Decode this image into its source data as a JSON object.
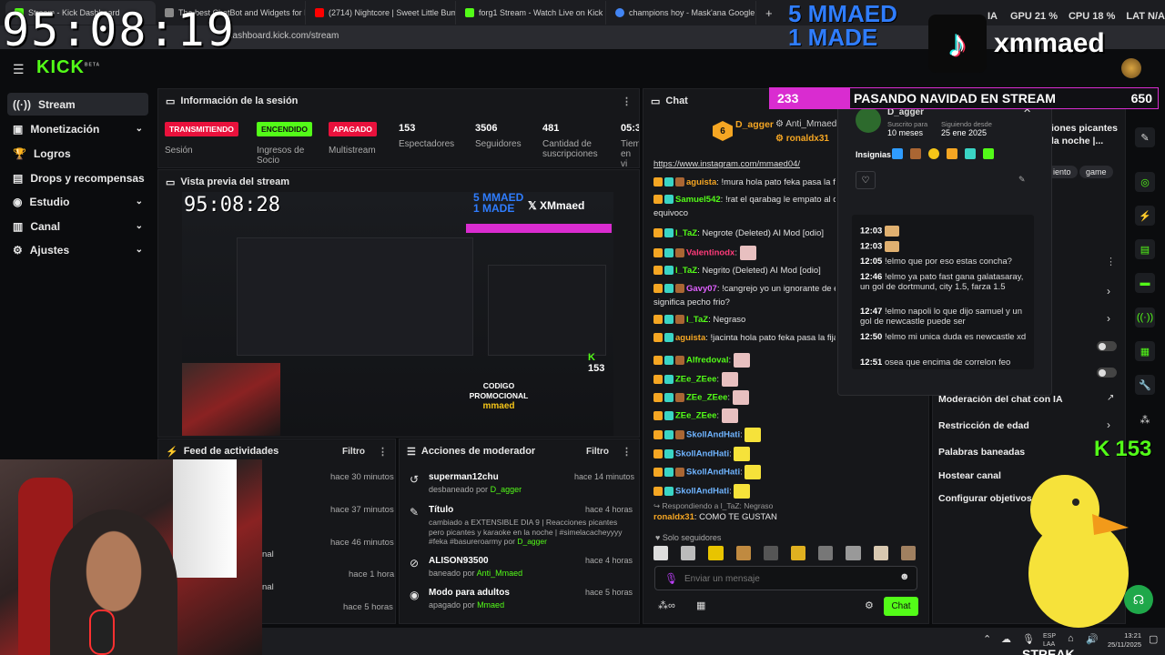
{
  "browser": {
    "tabs": [
      {
        "label": "Stream - Kick Dashboard",
        "color": "#53fc18"
      },
      {
        "label": "The best ChatBot and Widgets for K",
        "color": "#888888"
      },
      {
        "label": "(2714) Nightcore | Sweet Little Bumb",
        "color": "#ff0000"
      },
      {
        "label": "forg1 Stream - Watch Live on Kick",
        "color": "#53fc18"
      },
      {
        "label": "champions hoy - Mask'ana Google",
        "color": "#4285f4"
      }
    ],
    "new_tab": "+",
    "url": "dashboard.kick.com/stream"
  },
  "overlay": {
    "clock_main": "95:08:19",
    "mmaed_line1": "5 MMAED",
    "mmaed_line2": "1 MADE",
    "tiktok_handle": "xmmaed",
    "gpu_label": "GPU",
    "gpu_value": "21 %",
    "cpu_label": "CPU",
    "cpu_value": "18 %",
    "lat_label": "LAT",
    "lat_value": "N/A",
    "ia_partial": "IA"
  },
  "kick": {
    "logo": "KICK",
    "beta": "BETA"
  },
  "sidebar": {
    "items": [
      {
        "label": "Stream",
        "icon": "stream-icon",
        "chevron": false,
        "active": true
      },
      {
        "label": "Monetización",
        "icon": "money-icon",
        "chevron": true,
        "active": false
      },
      {
        "label": "Logros",
        "icon": "trophy-icon",
        "chevron": false,
        "active": false
      },
      {
        "label": "Drops y recompensas",
        "icon": "gift-icon",
        "chevron": false,
        "active": false
      },
      {
        "label": "Estudio",
        "icon": "studio-icon",
        "chevron": true,
        "active": false
      },
      {
        "label": "Canal",
        "icon": "channel-icon",
        "chevron": true,
        "active": false
      },
      {
        "label": "Ajustes",
        "icon": "gear-icon",
        "chevron": true,
        "active": false
      }
    ]
  },
  "session": {
    "title": "Información de la sesión",
    "badges": [
      {
        "text": "TRANSMITIENDO",
        "caption": "Sesión"
      },
      {
        "text": "ENCENDIDO",
        "caption": "Ingresos de Socio"
      },
      {
        "text": "APAGADO",
        "caption": "Multistream"
      }
    ],
    "stats": [
      {
        "value": "153",
        "label": "Espectadores"
      },
      {
        "value": "3506",
        "label": "Seguidores"
      },
      {
        "value": "481",
        "label": "Cantidad de suscripciones"
      },
      {
        "value": "05:3",
        "label": "Tiem en vi"
      }
    ]
  },
  "preview": {
    "title": "Vista previa del stream",
    "clock": "95:08:28",
    "mmaed_line1": "5 MMAED",
    "mmaed_line2": "1 MADE",
    "x_handle": "XMmaed",
    "promo_line1": "CODIGO",
    "promo_line2": "PROMOCIONAL",
    "promo_line3": "mmaed",
    "viewers": "153"
  },
  "activity": {
    "title": "Feed de actividades",
    "filter": "Filtro",
    "times": [
      "hace 30 minutos",
      "hace 37 minutos",
      "hace 46 minutos",
      "hace 1 hora",
      "hace 5 horas"
    ],
    "partial": [
      "nal",
      "nal"
    ]
  },
  "mod": {
    "title": "Acciones de moderador",
    "filter": "Filtro",
    "rows": [
      {
        "title": "superman12chu",
        "detail": "desbaneado por",
        "by": "D_agger",
        "time": "hace 14 minutos",
        "icon": "undo-icon"
      },
      {
        "title": "Título",
        "detail": "cambiado a EXTENSIBLE DIA 9 | Reacciones picantes pero picantes y karaoke en la noche | #simelacacheyyyy #feka #basureroarmy por",
        "by": "D_agger",
        "time": "hace 4 horas",
        "icon": "edit-icon"
      },
      {
        "title": "ALISON93500",
        "detail": "baneado por",
        "by": "Anti_Mmaed",
        "time": "hace 4 horas",
        "icon": "ban-icon"
      },
      {
        "title": "Modo para adultos",
        "detail": "apagado por",
        "by": "Mmaed",
        "time": "hace 5 horas",
        "icon": "adult-icon"
      }
    ]
  },
  "chat": {
    "title": "Chat",
    "pinned_user": "D_agger",
    "pinned_level": "6",
    "pinned_mod": "Anti_Mmaed",
    "pinned_user2": "ronaldx31",
    "link": "https://www.instagram.com/mmaed04/",
    "messages": [
      {
        "user": "aguista",
        "color": "#f5a623",
        "text": "!mura hola pato feka pasa la fija para"
      },
      {
        "user": "Samuel542",
        "color": "#53fc18",
        "text": "!rat el qarabag le empato al chel"
      },
      {
        "user": "",
        "color": "#ffffff",
        "text": "equivoco"
      },
      {
        "user": "l_TaZ",
        "color": "#53fc18",
        "text": "Negrote (Deleted)  AI Mod  [odio]"
      },
      {
        "user": "Valentinodx",
        "color": "#ff3b7a",
        "text": ""
      },
      {
        "user": "l_TaZ",
        "color": "#53fc18",
        "text": "Negrito (Deleted)  AI Mod  [odio]"
      },
      {
        "user": "Gavy07",
        "color": "#e060ff",
        "text": "!cangrejo yo un ignorante de el f"
      },
      {
        "user": "",
        "color": "#ffffff",
        "text": "significa pecho frio?"
      },
      {
        "user": "l_TaZ",
        "color": "#53fc18",
        "text": "Negraso"
      },
      {
        "user": "aguista",
        "color": "#f5a623",
        "text": "!jacinta hola pato feka pasa la fija pa"
      },
      {
        "user": "Alfredoval",
        "color": "#53fc18",
        "text": ""
      },
      {
        "user": "ZEe_ZEee",
        "color": "#53fc18",
        "text": ""
      },
      {
        "user": "ZEe_ZEee",
        "color": "#53fc18",
        "text": ""
      },
      {
        "user": "ZEe_ZEee",
        "color": "#53fc18",
        "text": ""
      },
      {
        "user": "SkollAndHati",
        "color": "#6fb4ff",
        "text": ""
      },
      {
        "user": "SkollAndHati",
        "color": "#6fb4ff",
        "text": ""
      },
      {
        "user": "SkollAndHati",
        "color": "#6fb4ff",
        "text": ""
      },
      {
        "user": "SkollAndHati",
        "color": "#6fb4ff",
        "text": ""
      }
    ],
    "reply_to": "Respondiendo a l_TaZ: Negraso",
    "last_user": "ronaldx31",
    "last_text": "COMO TE GUSTAN",
    "followers_only": "Solo seguidores",
    "placeholder": "Enviar un mensaje",
    "send": "Chat"
  },
  "banner": {
    "count": "233",
    "title": "PASANDO NAVIDAD EN STREAM",
    "viewers": "650"
  },
  "popup": {
    "user": "D_agger",
    "sub_label": "Suscrito para",
    "sub_value": "10 meses",
    "follow_label": "Siguiendo desde",
    "follow_value": "25 ene 2025",
    "badges_label": "Insignias",
    "log": [
      {
        "time": "12:03",
        "text": ""
      },
      {
        "time": "12:03",
        "text": ""
      },
      {
        "time": "12:05",
        "text": "!elmo que por eso estas concha?"
      },
      {
        "time": "12:46",
        "text": "!elmo ya pato fast gana galatasaray, un gol de dortmund, city 1.5, farza 1.5"
      },
      {
        "time": "12:47",
        "text": "!elmo napoli lo que dijo samuel y un gol de newcastle puede ser"
      },
      {
        "time": "12:50",
        "text": "!elmo mi unica duda es newcastle xd"
      },
      {
        "time": "12:51",
        "text": "osea que encima de correlon feo"
      }
    ]
  },
  "right_panel": {
    "title_partial1": "iones picantes",
    "title_partial2": "la noche |...",
    "tag1": "iento",
    "tag2": "game",
    "menu": [
      {
        "label": "Moderación del chat con IA",
        "icon": "external-icon"
      },
      {
        "label": "Restricción de edad",
        "icon": "chevron-right-icon"
      },
      {
        "label": "Palabras baneadas",
        "icon": ""
      },
      {
        "label": "Hostear canal",
        "icon": ""
      },
      {
        "label": "Configurar objetivos",
        "icon": "chevron-right-icon"
      }
    ],
    "viewers_overlay": "153"
  },
  "taskbar": {
    "lang1": "ESP",
    "lang2": "LAA",
    "time": "13:21",
    "date": "25/11/2025",
    "stream_partial": "STREAK"
  }
}
